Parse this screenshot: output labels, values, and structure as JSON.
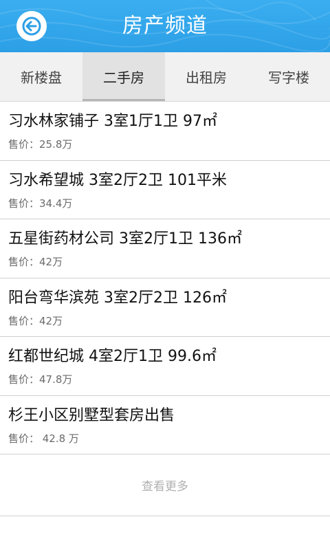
{
  "header": {
    "title": "房产频道"
  },
  "tabs": [
    {
      "label": "新楼盘",
      "active": false
    },
    {
      "label": "二手房",
      "active": true
    },
    {
      "label": "出租房",
      "active": false
    },
    {
      "label": "写字楼",
      "active": false
    }
  ],
  "listings": [
    {
      "title": "习水林家铺子 3室1厅1卫  97㎡",
      "price": "售价：25.8万"
    },
    {
      "title": "习水希望城 3室2厅2卫 101平米",
      "price": "售价：34.4万"
    },
    {
      "title": "五星街药材公司 3室2厅1卫 136㎡",
      "price": "售价：42万"
    },
    {
      "title": "阳台弯华滨苑 3室2厅2卫 126㎡",
      "price": "售价：42万"
    },
    {
      "title": "红都世纪城 4室2厅1卫 99.6㎡",
      "price": "售价：47.8万"
    },
    {
      "title": "杉王小区别墅型套房出售",
      "price": "售价： 42.8 万"
    }
  ],
  "more_label": "查看更多",
  "colors": {
    "header_blue": "#2c9fe6",
    "tab_active_bg": "#e2e2e2",
    "divider": "#cfcfcf"
  },
  "icons": {
    "back": "back-arrow-icon"
  }
}
